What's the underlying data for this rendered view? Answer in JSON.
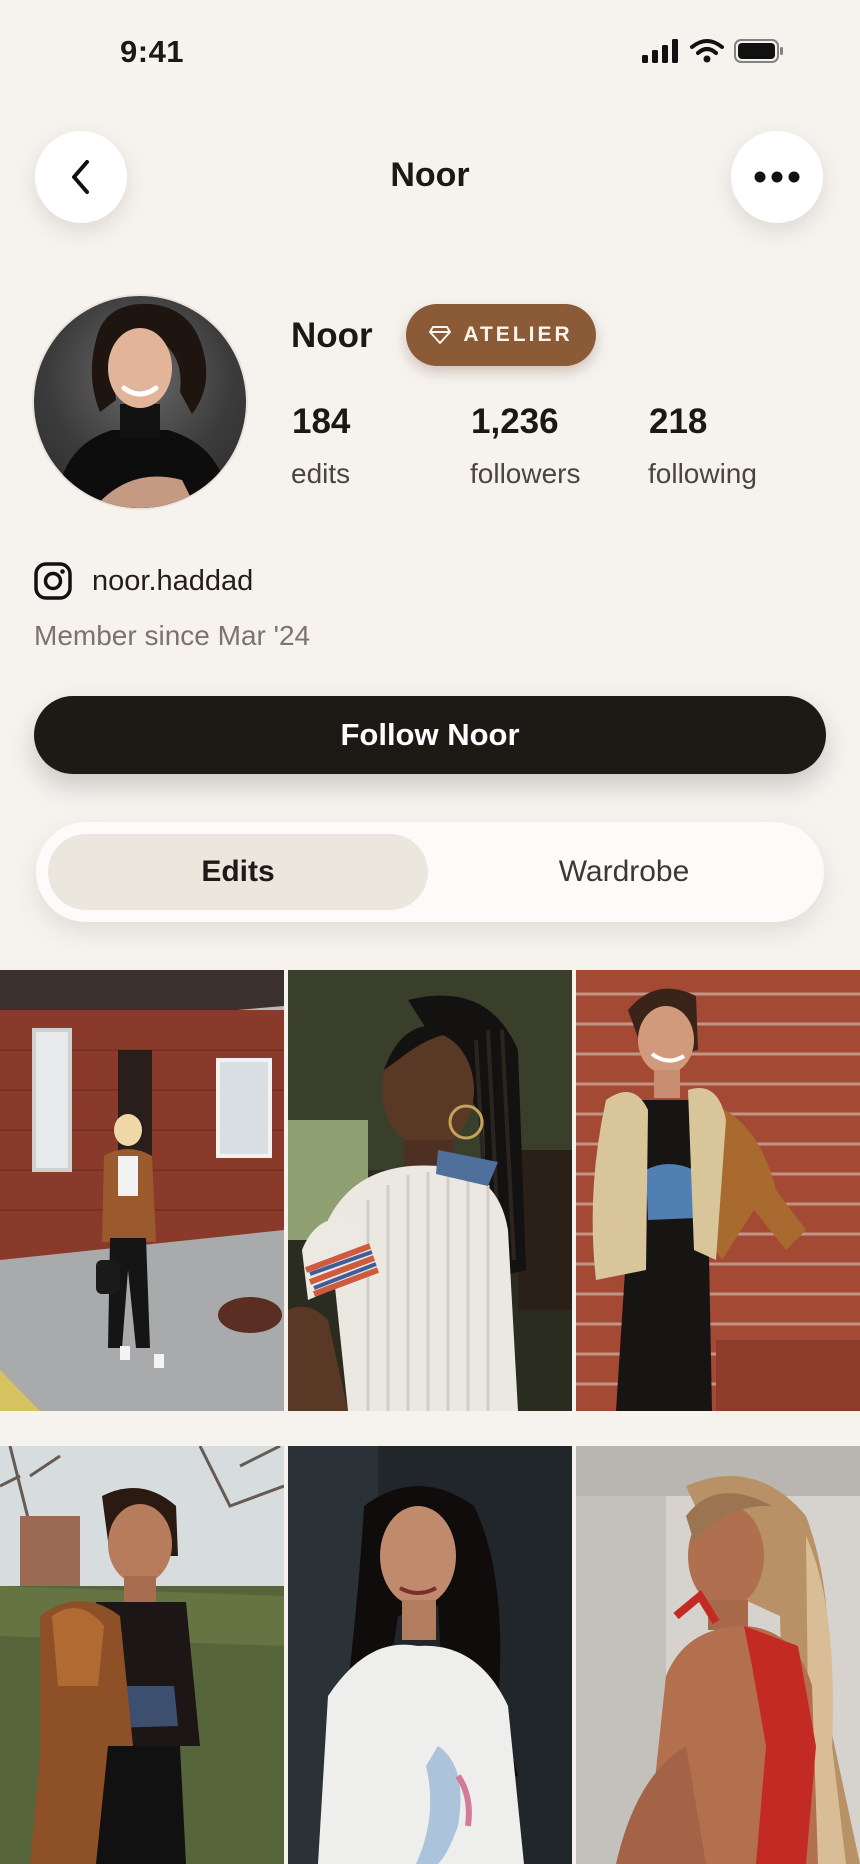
{
  "status_bar": {
    "time": "9:41"
  },
  "nav": {
    "title": "Noor"
  },
  "profile": {
    "name": "Noor",
    "badge": "ATELIER",
    "stats": [
      {
        "value": "184",
        "label": "edits"
      },
      {
        "value": "1,236",
        "label": "followers"
      },
      {
        "value": "218",
        "label": "following"
      }
    ],
    "instagram_handle": "noor.haddad",
    "member_since": "Member since Mar '24"
  },
  "follow_button": {
    "label": "Follow Noor"
  },
  "tabs": [
    {
      "label": "Edits",
      "active": true
    },
    {
      "label": "Wardrobe",
      "active": false
    }
  ],
  "grid": {
    "count": 6,
    "photos": [
      "outfit-photo",
      "outfit-photo",
      "outfit-photo",
      "outfit-photo",
      "outfit-photo",
      "outfit-photo"
    ]
  },
  "colors": {
    "background": "#f6f3ef",
    "badge": "#8b5a37",
    "primary_button": "#1d1915",
    "active_tab": "#ebe6de"
  }
}
